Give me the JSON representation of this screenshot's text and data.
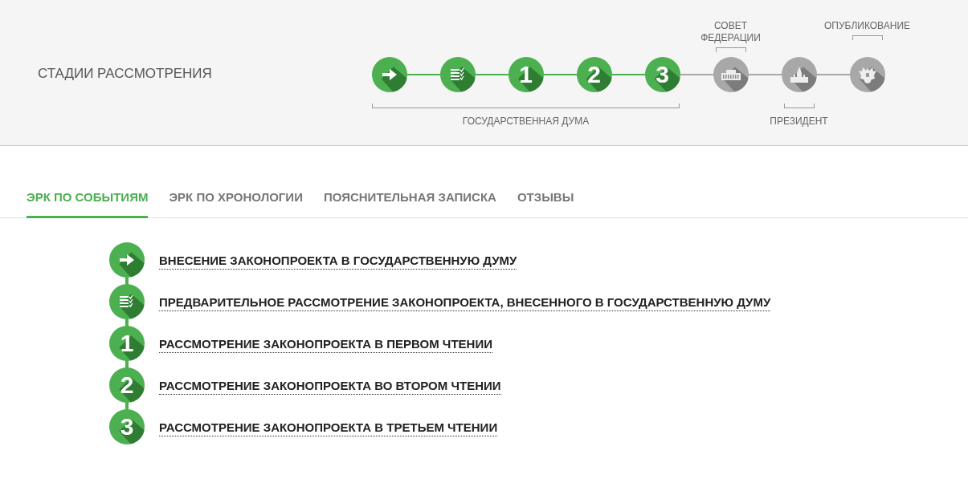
{
  "page_title": "СТАДИИ РАССМОТРЕНИЯ",
  "stepper": {
    "groups": [
      {
        "label": "ГОСУДАРСТВЕННАЯ ДУМА",
        "kind": "below",
        "stages": [
          {
            "kind": "arrow",
            "done": true
          },
          {
            "kind": "list",
            "done": true
          },
          {
            "kind": "number",
            "number": "1",
            "done": true
          },
          {
            "kind": "number",
            "number": "2",
            "done": true
          },
          {
            "kind": "number",
            "number": "3",
            "done": true
          }
        ]
      },
      {
        "label": "СОВЕТ ФЕДЕРАЦИИ",
        "kind": "above",
        "stages": [
          {
            "kind": "building",
            "done": false
          }
        ]
      },
      {
        "label": "ПРЕЗИДЕНТ",
        "kind": "below",
        "stages": [
          {
            "kind": "tower",
            "done": false
          }
        ]
      },
      {
        "label": "ОПУБЛИКОВАНИЕ",
        "kind": "above",
        "stages": [
          {
            "kind": "emblem",
            "done": false
          }
        ]
      }
    ]
  },
  "tabs": [
    {
      "label": "ЭРК ПО СОБЫТИЯМ",
      "selected": true
    },
    {
      "label": "ЭРК ПО ХРОНОЛОГИИ",
      "selected": false
    },
    {
      "label": "ПОЯСНИТЕЛЬНАЯ ЗАПИСКА",
      "selected": false
    },
    {
      "label": "ОТЗЫВЫ",
      "selected": false
    }
  ],
  "events": [
    {
      "kind": "arrow",
      "title": "ВНЕСЕНИЕ ЗАКОНОПРОЕКТА В ГОСУДАРСТВЕННУЮ ДУМУ"
    },
    {
      "kind": "list",
      "title": "ПРЕДВАРИТЕЛЬНОЕ РАССМОТРЕНИЕ ЗАКОНОПРОЕКТА, ВНЕСЕННОГО В ГОСУДАРСТВЕННУЮ ДУМУ"
    },
    {
      "kind": "number",
      "number": "1",
      "title": "РАССМОТРЕНИЕ ЗАКОНОПРОЕКТА В ПЕРВОМ ЧТЕНИИ"
    },
    {
      "kind": "number",
      "number": "2",
      "title": "РАССМОТРЕНИЕ ЗАКОНОПРОЕКТА ВО ВТОРОМ ЧТЕНИИ"
    },
    {
      "kind": "number",
      "number": "3",
      "title": "РАССМОТРЕНИЕ ЗАКОНОПРОЕКТА В ТРЕТЬЕМ ЧТЕНИИ"
    }
  ]
}
